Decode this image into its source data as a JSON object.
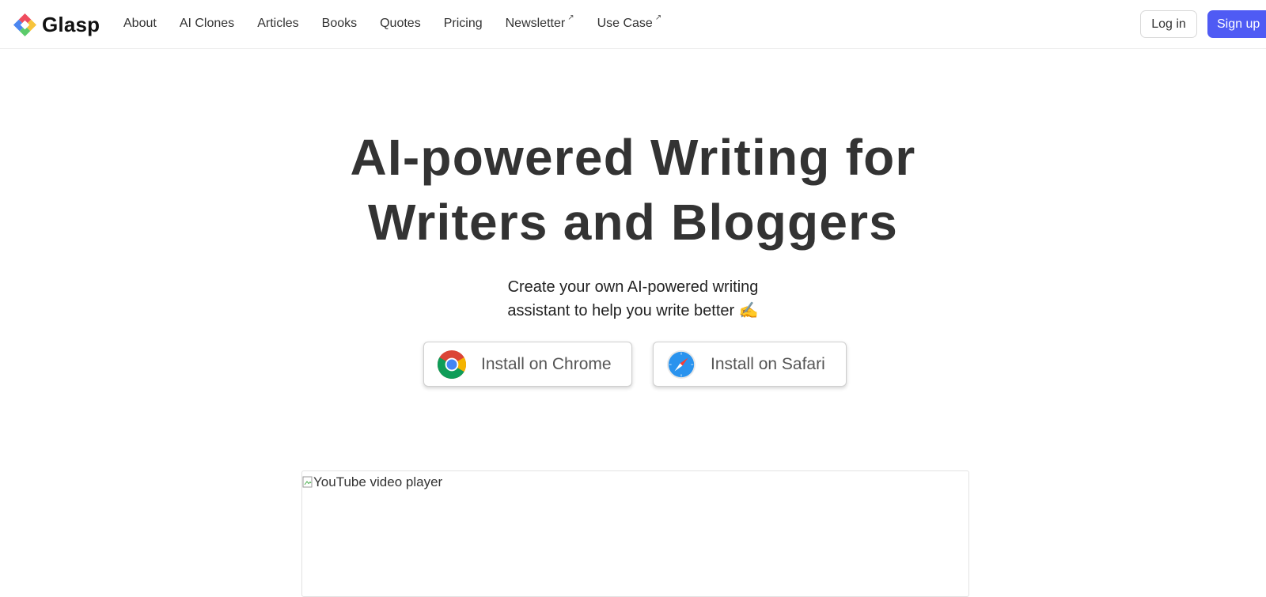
{
  "brand": {
    "name": "Glasp",
    "logo_colors": [
      "#ef4c5e",
      "#f7c43b",
      "#5bcb6a",
      "#4b86f0"
    ]
  },
  "nav": {
    "items": [
      {
        "label": "About",
        "external": false
      },
      {
        "label": "AI Clones",
        "external": false
      },
      {
        "label": "Articles",
        "external": false
      },
      {
        "label": "Books",
        "external": false
      },
      {
        "label": "Quotes",
        "external": false
      },
      {
        "label": "Pricing",
        "external": false
      },
      {
        "label": "Newsletter",
        "external": true
      },
      {
        "label": "Use Case",
        "external": true
      }
    ],
    "external_icon": "↗",
    "login_label": "Log in",
    "signup_label": "Sign up"
  },
  "hero": {
    "title_line1": "AI-powered Writing for",
    "title_line2": "Writers and Bloggers",
    "subtitle_line1": "Create your own AI-powered writing",
    "subtitle_line2": "assistant to help you write better ✍️"
  },
  "install": {
    "chrome_label": "Install on Chrome",
    "chrome_icon": "chrome-icon",
    "safari_label": "Install on Safari",
    "safari_icon": "safari-icon"
  },
  "video": {
    "alt_text": "YouTube video player"
  },
  "colors": {
    "accent": "#4f5bf4",
    "text": "#333333"
  }
}
